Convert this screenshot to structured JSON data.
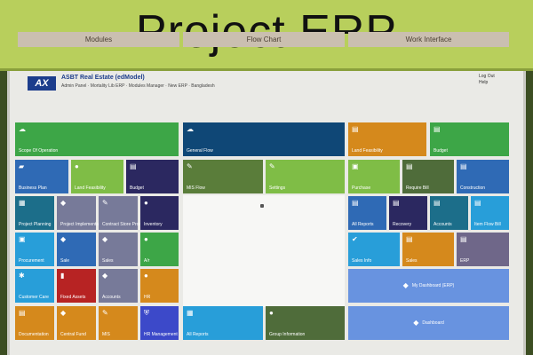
{
  "banner": {
    "title": "Project ERP"
  },
  "app": {
    "logo": "AX",
    "company": "ASBT Real Estate (edModel)",
    "subline": "Admin Panel · Mortality Lib ERP · Modules Manager · New ERP · Bangladesh",
    "logout": [
      "Log Out",
      "Help"
    ]
  },
  "columns": [
    "Modules",
    "Flow Chart",
    "Work Interface"
  ],
  "tiles": {
    "scope_operation": "Scope Of Operation",
    "business_plan": "Business Plan",
    "land_feasibility_1": "Land Feasibility",
    "budget_1": "Budget",
    "project_planning": "Project Planning",
    "project_implementation": "Project Implementation",
    "contract_store": "Contract Store Process",
    "inventory": "Inventory",
    "procurement": "Procurement",
    "sale": "Sale",
    "sales": "Sales",
    "ar": "A/r",
    "customer_care": "Customer Care",
    "fixed_assets": "Fixed Assets",
    "accounts": "Accounts",
    "hr": "HR",
    "documentation": "Documentation",
    "central_fund": "Central Fund",
    "mis": "MIS",
    "hr_management": "HR Management",
    "general_flow": "General Flow",
    "mis_flow": "MIS Flow",
    "settings": "Settings",
    "all_reports": "All Reports",
    "group_information": "Group Information",
    "land_feasibility_2": "Land Feasibility",
    "budget_2": "Budget",
    "purchase": "Purchase",
    "require_bill": "Require Bill",
    "construction": "Construction",
    "all_reports_2": "All Reports",
    "recovery": "Recovery",
    "accounts_2": "Accounts",
    "item_flow": "Item Flow Bill",
    "sales_info": "Sales Info",
    "sales_2": "Sales",
    "erp": "ERP",
    "my_dashboard": "My Dashboard (ERP)",
    "dashboard": "Dashboard"
  },
  "icons": {
    "scope": "cloud-icon",
    "doc": "document-icon",
    "user": "user-icon",
    "gear": "gear-icon",
    "bag": "bag-icon",
    "tag": "tag-icon",
    "check": "check-icon",
    "wrench": "wrench-icon"
  },
  "colors": {
    "banner": "#b8cf5c",
    "green": "#3da647",
    "blue": "#2f6ab5",
    "lightgreen": "#7fbd46",
    "navy": "#2b2860",
    "darkblue": "#0f4776",
    "olive": "#5a7d3a",
    "teal": "#1c6e8a",
    "gray_blue": "#777a99",
    "orange": "#d5891c",
    "sky": "#289ed9",
    "red": "#b72323",
    "dark_green": "#4f6c3a",
    "slate": "#6f6789",
    "periwinkle": "#6893e0"
  }
}
